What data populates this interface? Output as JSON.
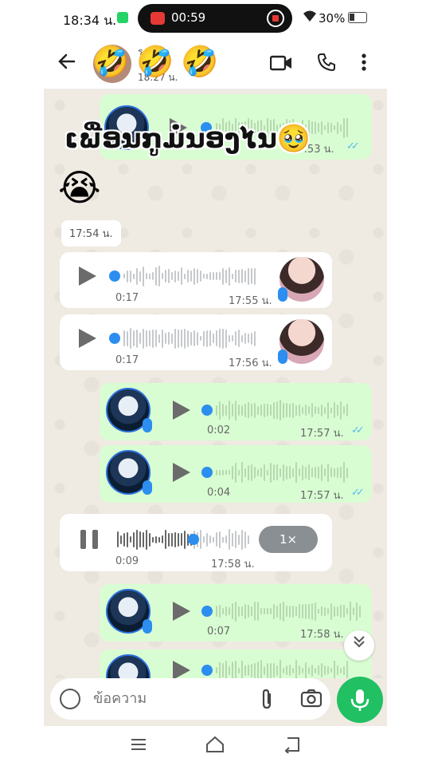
{
  "status_bar": {
    "time": "18:34 น.",
    "record_time": "00:59",
    "battery": "30%"
  },
  "header": {
    "contact_line1": "ร",
    "contact_line2": "18:27 น.",
    "emojis": [
      "🤣",
      "🤣",
      "🤣"
    ]
  },
  "overlay": {
    "caption": "ເພື່ອນກູມໍ່ນອງໄນ🥹",
    "emoji": "😭"
  },
  "date_chip": "17:54 น.",
  "messages": [
    {
      "direction": "out",
      "duration": "",
      "time": "17:53 น.",
      "read": true
    },
    {
      "direction": "in",
      "duration": "0:17",
      "time": "17:55 น."
    },
    {
      "direction": "in",
      "duration": "0:17",
      "time": "17:56 น."
    },
    {
      "direction": "out",
      "duration": "0:02",
      "time": "17:57 น.",
      "read": true
    },
    {
      "direction": "out",
      "duration": "0:04",
      "time": "17:57 น.",
      "read": true
    },
    {
      "direction": "in",
      "duration": "0:09",
      "time": "17:58 น.",
      "playing": true,
      "speed": "1×",
      "progress": 0.58
    },
    {
      "direction": "out",
      "duration": "0:07",
      "time": "17:58 น.",
      "read": true
    }
  ],
  "composer": {
    "placeholder": "ข้อความ"
  },
  "colors": {
    "outgoing_bubble": "#d9fdd3",
    "incoming_bubble": "#ffffff",
    "chat_bg": "#efeae2",
    "accent": "#21c063",
    "read_ticks": "#53bdeb",
    "voice_dot": "#2b8ef0"
  },
  "icons": [
    "back-arrow-icon",
    "video-call-icon",
    "phone-icon",
    "more-vert-icon",
    "play-icon",
    "pause-icon",
    "mic-icon",
    "sticker-icon",
    "attach-icon",
    "camera-icon",
    "scroll-down-icon",
    "nav-menu-icon",
    "nav-home-icon",
    "nav-back-icon"
  ]
}
